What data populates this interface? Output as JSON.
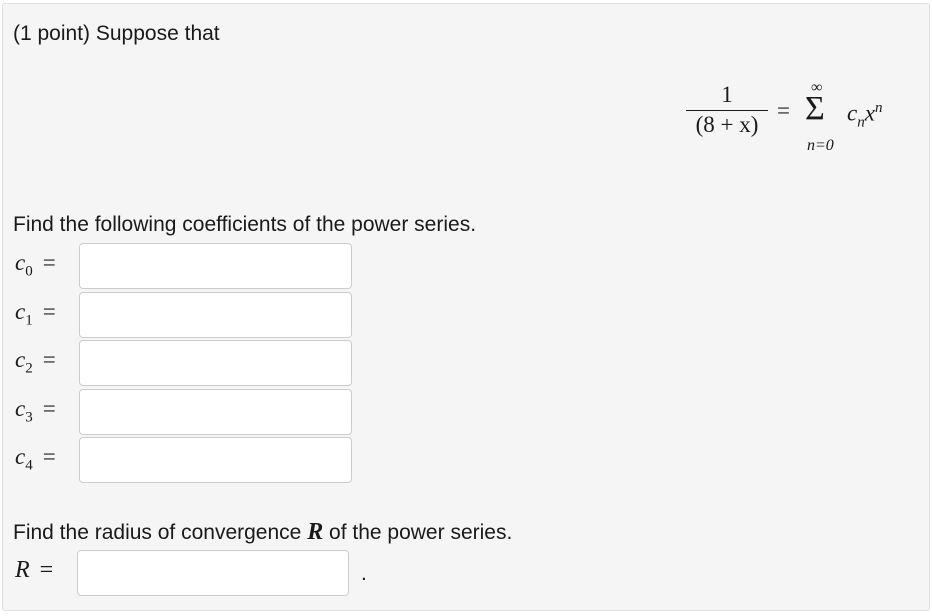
{
  "problem": {
    "intro": "(1 point) Suppose that",
    "equation": {
      "numerator": "1",
      "denominator": "(8 + x)",
      "equals": "=",
      "sum_upper": "∞",
      "sum_symbol": "Σ",
      "sum_lower": "n=0",
      "summand_base": "c",
      "summand_sub": "n",
      "summand_var": "x",
      "summand_sup": "n"
    },
    "coefficients_prompt": "Find the following coefficients of the power series.",
    "coefficients": [
      {
        "letter": "c",
        "index": "0",
        "equals": "=",
        "value": ""
      },
      {
        "letter": "c",
        "index": "1",
        "equals": "=",
        "value": ""
      },
      {
        "letter": "c",
        "index": "2",
        "equals": "=",
        "value": ""
      },
      {
        "letter": "c",
        "index": "3",
        "equals": "=",
        "value": ""
      },
      {
        "letter": "c",
        "index": "4",
        "equals": "=",
        "value": ""
      }
    ],
    "radius_prompt_before": "Find the radius of convergence ",
    "radius_symbol": "R",
    "radius_prompt_after": " of the power series.",
    "radius_label": "R",
    "radius_equals": "=",
    "radius_value": "",
    "trailing_period": "."
  }
}
